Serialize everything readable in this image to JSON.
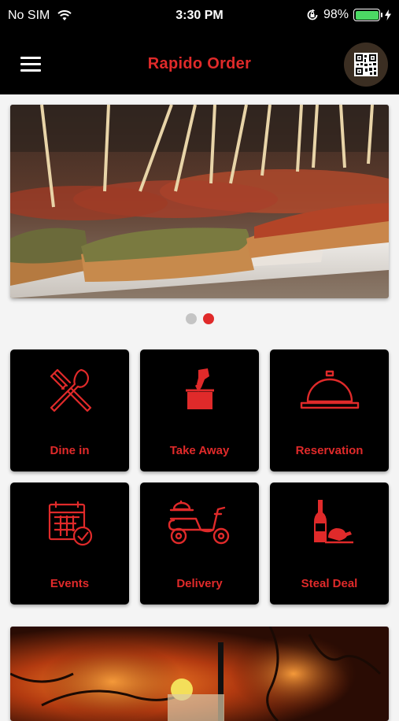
{
  "status_bar": {
    "carrier": "No SIM",
    "time": "3:30 PM",
    "battery_percent": "98%",
    "battery_level": 0.98,
    "icons": [
      "wifi-icon",
      "orientation-lock-icon",
      "battery-icon",
      "charging-icon"
    ]
  },
  "header": {
    "title": "Rapido Order",
    "menu_icon": "hamburger-menu-icon",
    "qr_icon": "qr-code-icon"
  },
  "carousel": {
    "slide_count": 2,
    "active_index": 1
  },
  "tiles": [
    {
      "label": "Dine in",
      "icon": "fork-knife-icon"
    },
    {
      "label": "Take Away",
      "icon": "takeaway-bag-icon"
    },
    {
      "label": "Reservation",
      "icon": "cloche-icon"
    },
    {
      "label": "Events",
      "icon": "calendar-check-icon"
    },
    {
      "label": "Delivery",
      "icon": "scooter-icon"
    },
    {
      "label": "Steal Deal",
      "icon": "wine-chicken-icon"
    }
  ],
  "colors": {
    "accent": "#e02a2a",
    "bar_bg": "#000000",
    "page_bg": "#f4f4f4"
  }
}
